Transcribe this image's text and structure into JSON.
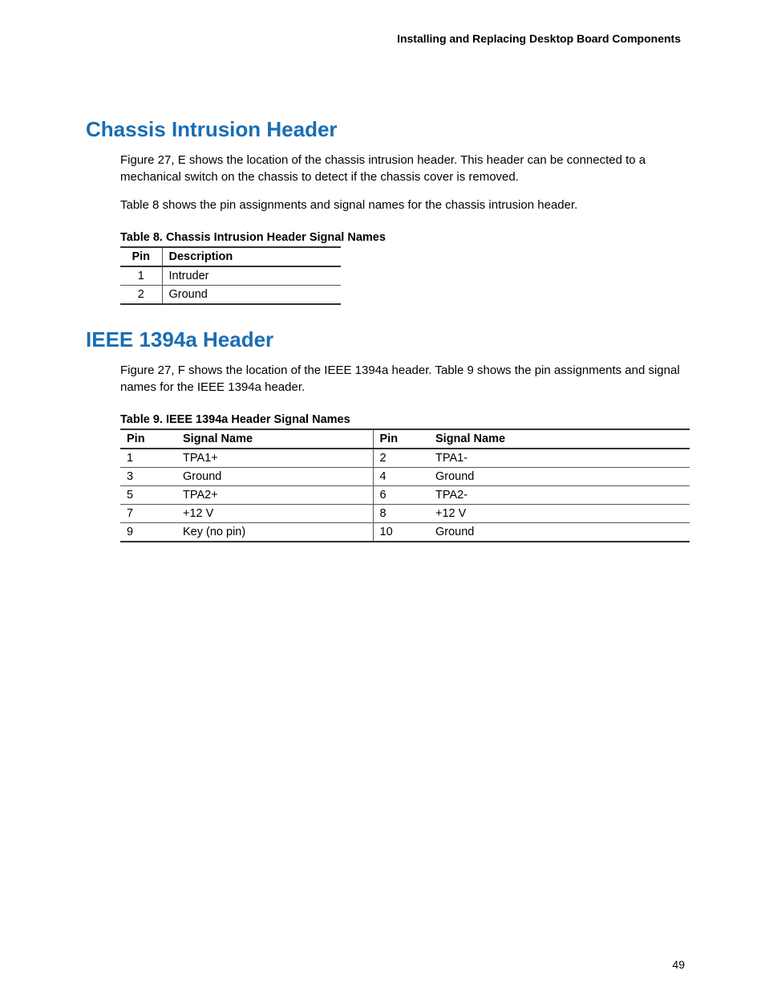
{
  "page_header": "Installing and Replacing Desktop Board Components",
  "page_number": "49",
  "section1": {
    "heading": "Chassis Intrusion Header",
    "para1": "Figure 27, E shows the location of the chassis intrusion header.  This header can be connected to a mechanical switch on the chassis to detect if the chassis cover is removed.",
    "para2": "Table 8 shows the pin assignments and signal names for the chassis intrusion header.",
    "table_caption": "Table 8.  Chassis Intrusion Header Signal Names",
    "table": {
      "headers": {
        "c1": "Pin",
        "c2": "Description"
      },
      "rows": [
        {
          "c1": "1",
          "c2": "Intruder"
        },
        {
          "c1": "2",
          "c2": "Ground"
        }
      ]
    }
  },
  "section2": {
    "heading": "IEEE 1394a Header",
    "para1": "Figure 27, F shows the location of the IEEE 1394a header.  Table 9 shows the pin assignments and signal names for the IEEE 1394a header.",
    "table_caption": "Table 9.  IEEE 1394a Header Signal Names",
    "table": {
      "headers": {
        "c1": "Pin",
        "c2": "Signal Name",
        "c3": "Pin",
        "c4": "Signal Name"
      },
      "rows": [
        {
          "c1": "1",
          "c2": "TPA1+",
          "c3": "2",
          "c4": "TPA1-"
        },
        {
          "c1": "3",
          "c2": "Ground",
          "c3": "4",
          "c4": "Ground"
        },
        {
          "c1": "5",
          "c2": "TPA2+",
          "c3": "6",
          "c4": "TPA2-"
        },
        {
          "c1": "7",
          "c2": "+12 V",
          "c3": "8",
          "c4": "+12 V"
        },
        {
          "c1": "9",
          "c2": "Key (no pin)",
          "c3": "10",
          "c4": "Ground"
        }
      ]
    }
  }
}
